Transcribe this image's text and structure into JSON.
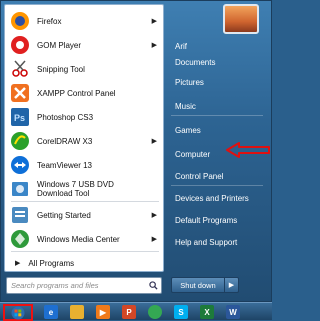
{
  "programs": [
    {
      "label": "Firefox",
      "icon": "firefox-icon",
      "color": "#e66000",
      "submenu": true
    },
    {
      "label": "GOM Player",
      "icon": "gom-player-icon",
      "color": "#e02020",
      "submenu": true
    },
    {
      "label": "Snipping Tool",
      "icon": "scissors-icon",
      "color": "#c8d8e8",
      "submenu": false
    },
    {
      "label": "XAMPP Control Panel",
      "icon": "xampp-icon",
      "color": "#f07020",
      "submenu": false
    },
    {
      "label": "Photoshop CS3",
      "icon": "photoshop-icon",
      "color": "#1f64a8",
      "submenu": false
    },
    {
      "label": "CorelDRAW X3",
      "icon": "coreldraw-icon",
      "color": "#2aa02a",
      "submenu": true
    },
    {
      "label": "TeamViewer 13",
      "icon": "teamviewer-icon",
      "color": "#0e6fd8",
      "submenu": false
    },
    {
      "label": "Windows 7 USB DVD Download Tool",
      "icon": "usb-dvd-tool-icon",
      "color": "#3a86c8",
      "submenu": false
    },
    {
      "label": "Getting Started",
      "icon": "getting-started-icon",
      "color": "#4a8ac0",
      "submenu": true
    },
    {
      "label": "Windows Media Center",
      "icon": "media-center-icon",
      "color": "#2e9a3a",
      "submenu": true
    }
  ],
  "all_programs": "All Programs",
  "search_placeholder": "Search programs and files",
  "right_items": [
    {
      "label": "Arif",
      "highlight": false
    },
    {
      "label": "Documents",
      "highlight": false
    },
    {
      "label": "Pictures",
      "highlight": false
    },
    {
      "label": "Music",
      "highlight": false
    },
    {
      "label": "Games",
      "highlight": false
    },
    {
      "label": "Computer",
      "highlight": false
    },
    {
      "label": "Control Panel",
      "highlight": true
    },
    {
      "label": "Devices and Printers",
      "highlight": false
    },
    {
      "label": "Default Programs",
      "highlight": false
    },
    {
      "label": "Help and Support",
      "highlight": false
    }
  ],
  "shutdown_label": "Shut down",
  "taskbar_icons": [
    "ie-icon",
    "explorer-icon",
    "media-player-icon",
    "powerpoint-icon",
    "chrome-icon",
    "skype-icon",
    "excel-icon",
    "word-icon"
  ],
  "accent": "#e01010"
}
